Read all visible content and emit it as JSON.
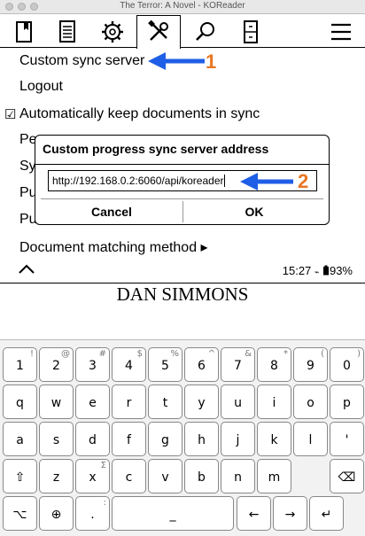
{
  "window": {
    "title": "The Terror: A Novel - KOReader"
  },
  "toolbar": {
    "icons": [
      "book-bookmark-icon",
      "document-list-icon",
      "gear-icon",
      "tools-icon",
      "search-icon",
      "filebox-icon",
      "hamburger-menu-icon"
    ]
  },
  "menu": {
    "items": [
      "Custom sync server",
      "Logout",
      "Automatically keep documents in sync",
      "Pe",
      "Sy",
      "Pu",
      "Pu",
      "Document matching method ▸"
    ],
    "checkbox_mark": "☑",
    "footer": {
      "time": "15:27",
      "wifi": "⌁",
      "battery": "93%"
    }
  },
  "annotations": {
    "one": "1",
    "two": "2"
  },
  "dialog": {
    "title": "Custom progress sync server address",
    "input_value": "http://192.168.0.2:6060/api/koreader",
    "cancel_label": "Cancel",
    "ok_label": "OK"
  },
  "book": {
    "author": "DAN SIMMONS"
  },
  "keyboard": {
    "row1": [
      {
        "k": "1",
        "a": "!"
      },
      {
        "k": "2",
        "a": "@"
      },
      {
        "k": "3",
        "a": "#"
      },
      {
        "k": "4",
        "a": "$"
      },
      {
        "k": "5",
        "a": "%"
      },
      {
        "k": "6",
        "a": "^"
      },
      {
        "k": "7",
        "a": "&"
      },
      {
        "k": "8",
        "a": "*"
      },
      {
        "k": "9",
        "a": "("
      },
      {
        "k": "0",
        "a": ")"
      }
    ],
    "row2": [
      {
        "k": "q",
        "a": ""
      },
      {
        "k": "w",
        "a": ""
      },
      {
        "k": "e",
        "a": ""
      },
      {
        "k": "r",
        "a": ""
      },
      {
        "k": "t",
        "a": ""
      },
      {
        "k": "y",
        "a": ""
      },
      {
        "k": "u",
        "a": ""
      },
      {
        "k": "i",
        "a": ""
      },
      {
        "k": "o",
        "a": ""
      },
      {
        "k": "p",
        "a": ""
      }
    ],
    "row3": [
      {
        "k": "a",
        "a": ""
      },
      {
        "k": "s",
        "a": ""
      },
      {
        "k": "d",
        "a": ""
      },
      {
        "k": "f",
        "a": ""
      },
      {
        "k": "g",
        "a": ""
      },
      {
        "k": "h",
        "a": ""
      },
      {
        "k": "j",
        "a": ""
      },
      {
        "k": "k",
        "a": ""
      },
      {
        "k": "l",
        "a": ""
      },
      {
        "k": "'",
        "a": ""
      }
    ],
    "row4": [
      {
        "k": "⇧",
        "a": ""
      },
      {
        "k": "z",
        "a": ""
      },
      {
        "k": "x",
        "a": "Σ"
      },
      {
        "k": "c",
        "a": ""
      },
      {
        "k": "v",
        "a": ""
      },
      {
        "k": "b",
        "a": ""
      },
      {
        "k": "n",
        "a": ""
      },
      {
        "k": "m",
        "a": ""
      },
      {
        "k": "⌫",
        "a": ""
      }
    ],
    "row5": [
      {
        "k": "⌥",
        "a": ""
      },
      {
        "k": "⊕",
        "a": ""
      },
      {
        "k": ".",
        "a": ":"
      },
      {
        "k": "_",
        "a": ""
      },
      {
        "k": "←",
        "a": ""
      },
      {
        "k": "→",
        "a": ""
      },
      {
        "k": "↵",
        "a": ""
      }
    ]
  }
}
